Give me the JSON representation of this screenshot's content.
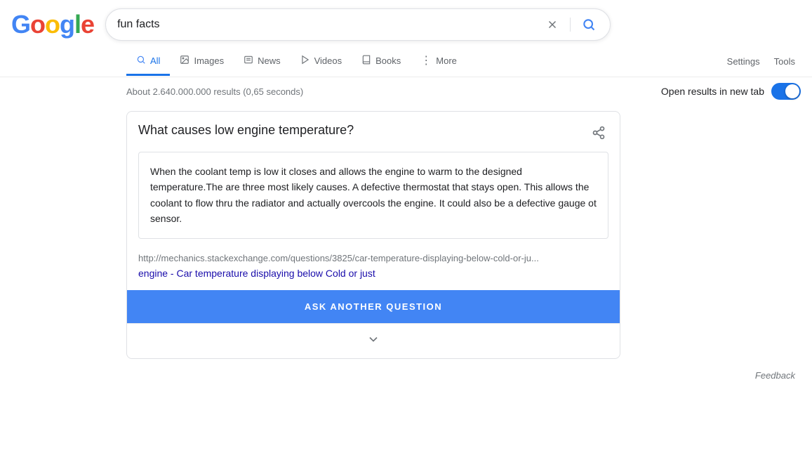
{
  "logo": {
    "letters": [
      {
        "char": "G",
        "color": "#4285F4"
      },
      {
        "char": "o",
        "color": "#EA4335"
      },
      {
        "char": "o",
        "color": "#FBBC05"
      },
      {
        "char": "g",
        "color": "#4285F4"
      },
      {
        "char": "l",
        "color": "#34A853"
      },
      {
        "char": "e",
        "color": "#EA4335"
      }
    ],
    "text": "Google"
  },
  "search": {
    "query": "fun facts",
    "clear_label": "×",
    "search_label": "🔍"
  },
  "nav": {
    "tabs": [
      {
        "id": "all",
        "label": "All",
        "icon": "🔍",
        "active": true
      },
      {
        "id": "images",
        "label": "Images",
        "icon": "🖼",
        "active": false
      },
      {
        "id": "news",
        "label": "News",
        "icon": "📰",
        "active": false
      },
      {
        "id": "videos",
        "label": "Videos",
        "icon": "▶",
        "active": false
      },
      {
        "id": "books",
        "label": "Books",
        "icon": "📖",
        "active": false
      },
      {
        "id": "more",
        "label": "More",
        "icon": "⋮",
        "active": false
      }
    ],
    "settings_label": "Settings",
    "tools_label": "Tools"
  },
  "results_bar": {
    "count_text": "About 2.640.000.000 results (0,65 seconds)",
    "new_tab_label": "Open results in new tab",
    "toggle_on": true
  },
  "snippet": {
    "question": "What causes low engine temperature?",
    "answer": "When the coolant temp is low it closes and allows the engine to warm to the designed temperature.The are three most likely causes. A defective thermostat that stays open. This allows the coolant to flow thru the radiator and actually overcools the engine. It could also be a defective gauge ot sensor.",
    "url": "http://mechanics.stackexchange.com/questions/3825/car-temperature-displaying-below-cold-or-ju...",
    "link_text": "engine - Car temperature displaying below Cold or just",
    "ask_btn_label": "ASK ANOTHER QUESTION",
    "share_icon": "share"
  },
  "feedback": {
    "label": "Feedback"
  }
}
